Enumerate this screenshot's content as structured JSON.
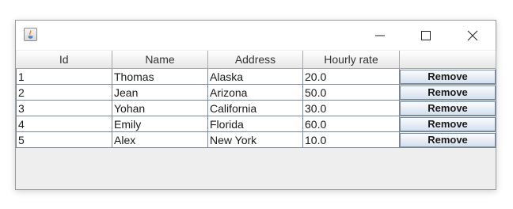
{
  "window": {
    "title": "",
    "controls": {
      "minimize_icon": "minimize-icon",
      "maximize_icon": "maximize-icon",
      "close_icon": "close-icon"
    }
  },
  "table": {
    "columns": [
      "Id",
      "Name",
      "Address",
      "Hourly rate",
      ""
    ],
    "rows": [
      {
        "id": "1",
        "name": "Thomas",
        "address": "Alaska",
        "rate": "20.0",
        "action": "Remove"
      },
      {
        "id": "2",
        "name": "Jean",
        "address": "Arizona",
        "rate": "50.0",
        "action": "Remove"
      },
      {
        "id": "3",
        "name": "Yohan",
        "address": "California",
        "rate": "30.0",
        "action": "Remove"
      },
      {
        "id": "4",
        "name": "Emily",
        "address": "Florida",
        "rate": "60.0",
        "action": "Remove"
      },
      {
        "id": "5",
        "name": "Alex",
        "address": "New York",
        "rate": "10.0",
        "action": "Remove"
      }
    ]
  }
}
